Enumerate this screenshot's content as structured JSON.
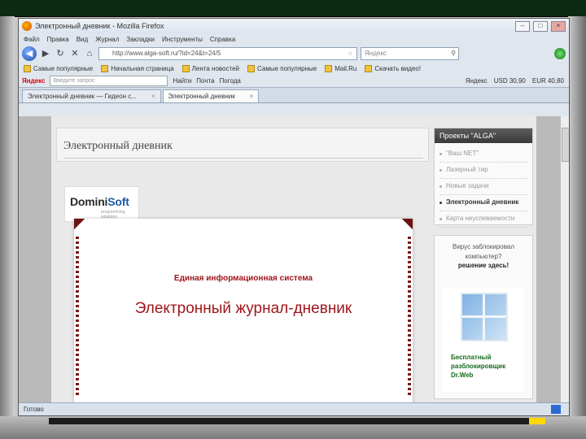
{
  "window": {
    "title": "Электронный дневник - Mozilla Firefox",
    "buttons": {
      "minimize": "–",
      "maximize": "□",
      "close": "×"
    }
  },
  "menubar": [
    "Файл",
    "Правка",
    "Вид",
    "Журнал",
    "Закладки",
    "Инструменты",
    "Справка"
  ],
  "navbar": {
    "url": "http://www.alga-soft.ru/?id=24&t=24/5",
    "search_placeholder": "Яндекс"
  },
  "bookmarks": [
    "Самые популярные",
    "Начальная страница",
    "Лента новостей",
    "Самые популярные",
    "Mail.Ru",
    "Скачать видео!"
  ],
  "yandex_bar": {
    "logo": "Яндекс",
    "input_placeholder": "Введите запрос",
    "find": "Найти",
    "mail": "Почта",
    "weather": "Погода",
    "rate_label": "Яндекс",
    "usd": "USD 30,90",
    "eur": "EUR 40,80"
  },
  "tabs": [
    {
      "label": "Электронный дневник — Гидеон с..."
    },
    {
      "label": "Электронный дневник"
    }
  ],
  "page": {
    "heading": "Электронный дневник",
    "logo": {
      "brand_a": "Domini",
      "brand_b": "Soft",
      "tagline": "programming solutions"
    },
    "slide": {
      "subtitle": "Единая информационная система",
      "title": "Электронный журнал-дневник"
    }
  },
  "sidebar": {
    "header": "Проекты \"ALGA\"",
    "items": [
      "\"Ваш NET\"",
      "Лазерный тир",
      "Новые задачи",
      "Электронный дневник",
      "Карта неуспеваемости"
    ],
    "current_index": 3,
    "ad": {
      "line1": "Вирус заблокировал компьютер?",
      "line2": "решение здесь!",
      "product": "Бесплатный разблокировщик Dr.Web"
    }
  },
  "statusbar": {
    "text": "Готово"
  },
  "colors": {
    "slide_text": "#a0161b",
    "sidebar_header": "#4a4a4a",
    "frame": "#0c2a12"
  }
}
